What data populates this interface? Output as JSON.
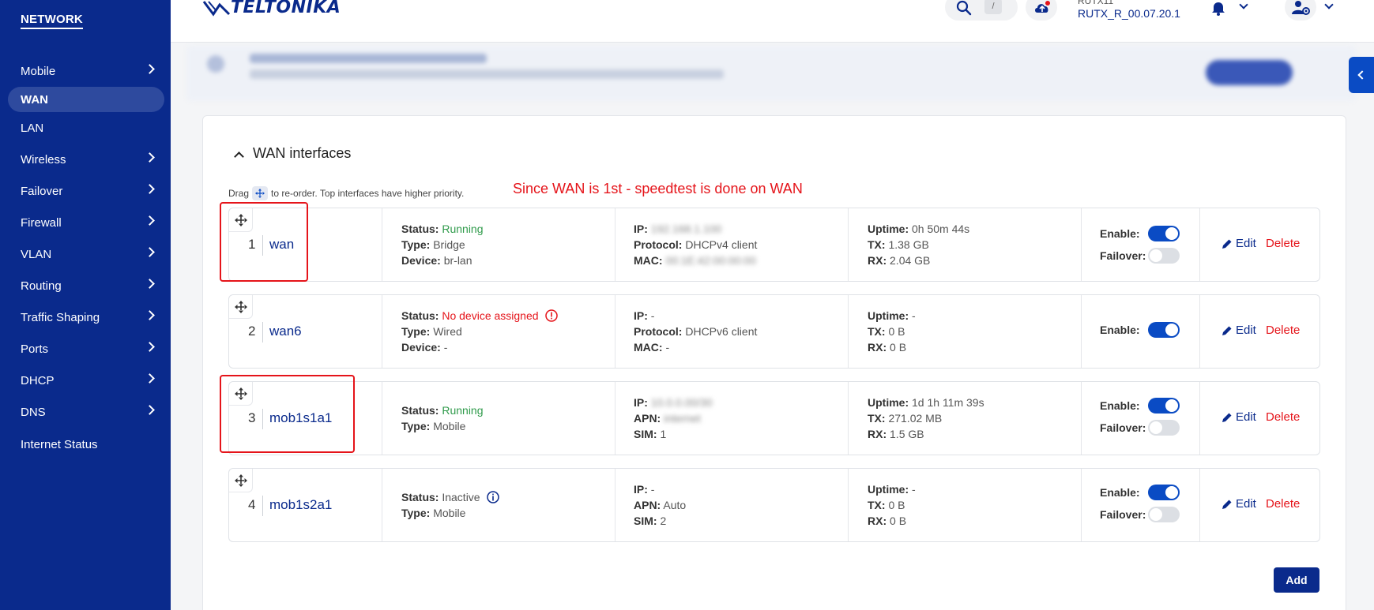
{
  "sidebar": {
    "section": "NETWORK",
    "items": [
      {
        "label": "Mobile",
        "chevron": true
      },
      {
        "label": "WAN",
        "chevron": false,
        "active": true
      },
      {
        "label": "LAN",
        "chevron": false
      },
      {
        "label": "Wireless",
        "chevron": true
      },
      {
        "label": "Failover",
        "chevron": true
      },
      {
        "label": "Firewall",
        "chevron": true
      },
      {
        "label": "VLAN",
        "chevron": true
      },
      {
        "label": "Routing",
        "chevron": true
      },
      {
        "label": "Traffic Shaping",
        "chevron": true
      },
      {
        "label": "Ports",
        "chevron": true
      },
      {
        "label": "DHCP",
        "chevron": true
      },
      {
        "label": "DNS",
        "chevron": true
      },
      {
        "label": "Internet Status",
        "chevron": false
      }
    ]
  },
  "header": {
    "logo": "TELTONIKA",
    "search_shortcut": "/",
    "device_name": "RUTX11",
    "firmware": "RUTX_R_00.07.20.1"
  },
  "main": {
    "section_title": "WAN interfaces",
    "hint_before": "Drag",
    "hint_after": "to re-order. Top interfaces have higher priority.",
    "annotation": "Since WAN is 1st - speedtest is done on WAN",
    "labels": {
      "status": "Status:",
      "type": "Type:",
      "device": "Device:",
      "ip": "IP:",
      "protocol": "Protocol:",
      "mac": "MAC:",
      "apn": "APN:",
      "sim": "SIM:",
      "uptime": "Uptime:",
      "tx": "TX:",
      "rx": "RX:",
      "enable": "Enable:",
      "failover": "Failover:",
      "edit": "Edit",
      "delete": "Delete"
    },
    "interfaces": [
      {
        "index": "1",
        "name": "wan",
        "status": "Running",
        "type": "Bridge",
        "device": "br-lan",
        "ip": "192.168.1.100",
        "protocol": "DHCPv4 client",
        "mac": "00:1E:42:00:00:00",
        "uptime": "0h 50m 44s",
        "tx": "1.38 GB",
        "rx": "2.04 GB",
        "enabled": true,
        "failover": false
      },
      {
        "index": "2",
        "name": "wan6",
        "status": "No device assigned",
        "type": "Wired",
        "device": "-",
        "ip": "-",
        "protocol": "DHCPv6 client",
        "mac": "-",
        "uptime": "-",
        "tx": "0 B",
        "rx": "0 B",
        "enabled": true
      },
      {
        "index": "3",
        "name": "mob1s1a1",
        "status": "Running",
        "type": "Mobile",
        "ip": "10.0.0.00/30",
        "apn": "internet",
        "sim": "1",
        "uptime": "1d 1h 11m 39s",
        "tx": "271.02 MB",
        "rx": "1.5 GB",
        "enabled": true,
        "failover": false
      },
      {
        "index": "4",
        "name": "mob1s2a1",
        "status": "Inactive",
        "type": "Mobile",
        "ip": "-",
        "apn": "Auto",
        "sim": "2",
        "uptime": "-",
        "tx": "0 B",
        "rx": "0 B",
        "enabled": true,
        "failover": false
      }
    ],
    "add_label": "Add"
  },
  "colors": {
    "sidebar_bg": "#0a2a8c",
    "accent": "#0a4bc4",
    "running": "#2e9a4a",
    "error": "#e5141a"
  }
}
